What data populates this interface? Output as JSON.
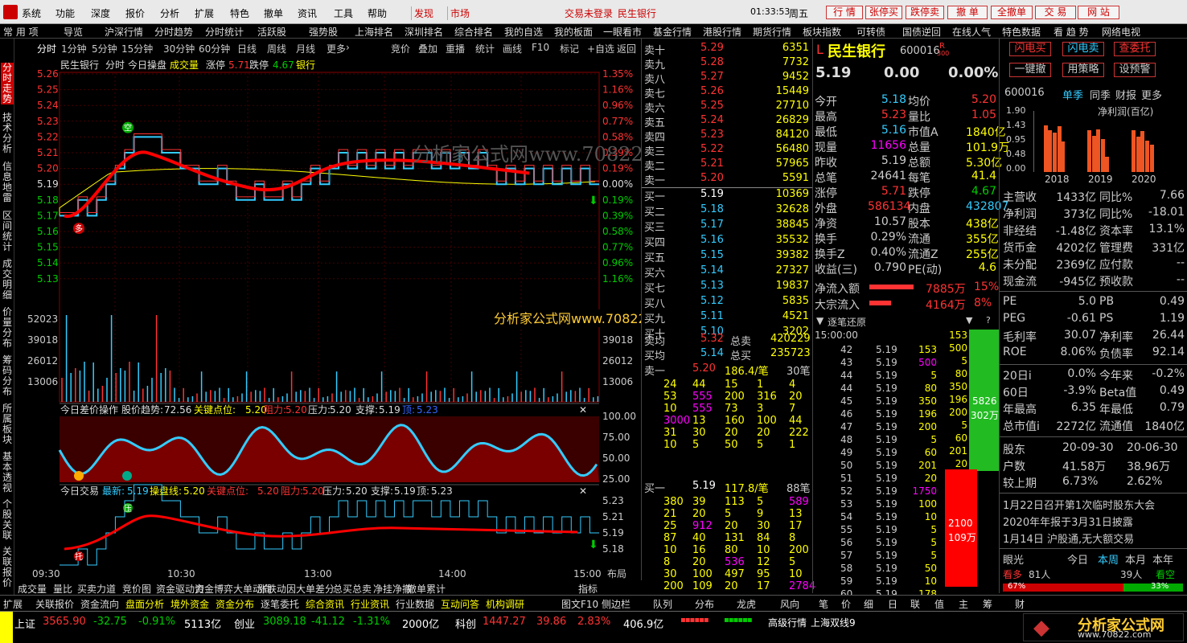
{
  "menu": {
    "items": [
      "系统",
      "功能",
      "深度",
      "报价",
      "分析",
      "扩展",
      "特色",
      "撤单",
      "资讯",
      "工具",
      "帮助"
    ],
    "find": "发现",
    "market": "市场",
    "login_status": "交易未登录",
    "broker": "民生银行",
    "time": "01:33:53",
    "weekday": "周五",
    "buttons": [
      "行 情",
      "张停买",
      "跌停卖",
      "撤 单",
      "全撤单",
      "交 易",
      "网 站"
    ]
  },
  "nav": {
    "items": [
      "常 用 项",
      "导览",
      "沪深行情",
      "分时趋势",
      "分时统计",
      "活跃股",
      "强势股",
      "上海排名",
      "深圳排名",
      "综合排名",
      "我的自选",
      "我的板面",
      "一眼看市",
      "基金行情",
      "港股行情",
      "期货行情",
      "板块指数",
      "可转债",
      "国债逆回",
      "在线人气",
      "特色数据",
      "看 趋 势",
      "网络电视"
    ]
  },
  "leftbar": [
    "分时走势",
    "技术分析",
    "信息地雷",
    "区间统计",
    "成交明细",
    "价量分布",
    "筹码分布",
    "所属板块",
    "基本透视",
    "个股关联",
    "关联报价"
  ],
  "toolbar": {
    "periods": [
      "分时",
      "1分钟",
      "5分钟",
      "15分钟",
      "30分钟",
      "60分钟",
      "日线",
      "周线",
      "月线",
      "更多"
    ],
    "tools": [
      "竞价",
      "叠加",
      "重播",
      "统计",
      "画线",
      "F10",
      "标记",
      "+自选",
      "返回"
    ]
  },
  "chart_header": {
    "name": "民生银行",
    "mode": "分时",
    "today": "今日操盘",
    "cyan_label": "成交量",
    "zt_label": "涨停",
    "zt": "5.71",
    "dt_label": "跌停",
    "dt": "4.67",
    "sector": "银行"
  },
  "watermark": "分析家公式网www.70822.com",
  "watermark_small": "分析家公式网www.70822.com",
  "chart_data": {
    "type": "line",
    "title": "分时趋势",
    "yaxis_left": [
      "5.26",
      "5.25",
      "5.24",
      "5.23",
      "5.22",
      "5.21",
      "5.20",
      "5.19",
      "5.18",
      "5.17",
      "5.16",
      "5.15",
      "5.14",
      "5.13"
    ],
    "yaxis_right": [
      "1.35%",
      "1.16%",
      "0.96%",
      "0.77%",
      "0.58%",
      "0.39%",
      "0.19%",
      "0.00%",
      "0.19%",
      "0.39%",
      "0.58%",
      "0.77%",
      "0.96%",
      "1.16%"
    ],
    "vol_axis": [
      "52023",
      "39018",
      "26012",
      "13006"
    ],
    "xaxis": [
      "09:30",
      "10:30",
      "13:00",
      "14:00",
      "15:00"
    ],
    "prev_close": 5.19,
    "marks": {
      "up": "空",
      "down": "多"
    }
  },
  "panel2": {
    "title": "今日差价操作",
    "l1": "股价趋势:",
    "v1": "72.56",
    "l2": "关键点位:",
    "v2": "5.20",
    "l3": "阻力:",
    "v3": "5.20",
    "l4": "压力:",
    "v4": "5.20",
    "l5": "支撑:",
    "v5": "5.19",
    "l6": "顶:",
    "v6": "5.23",
    "axis": [
      "100.00",
      "75.00",
      "50.00",
      "25.00"
    ]
  },
  "panel3": {
    "title": "今日交易",
    "l1": "最新:",
    "v1": "5.19",
    "l2": "操盘线:",
    "v2": "5.20",
    "l3": "关键点位:",
    "v3": "5.20",
    "l4": "阻力:",
    "v4": "5.20",
    "l5": "压力:",
    "v5": "5.20",
    "l6": "支撑:",
    "v6": "5.19",
    "l7": "顶:",
    "v7": "5.23",
    "axis": [
      "5.23",
      "5.21",
      "5.19",
      "5.18"
    ],
    "marks": {
      "up": "压",
      "down": "托"
    }
  },
  "chart_bottom_tabs": [
    "成交量",
    "量比",
    "买卖力道",
    "竞价图",
    "资金驱动力",
    "资金博弈",
    "大单动向",
    "涨跌动因",
    "大单差分",
    "总买总卖",
    "净挂净撤",
    "撤单累计"
  ],
  "bottom_right": [
    "布局",
    "指标"
  ],
  "orderbook": {
    "sell": [
      [
        "卖十",
        "5.29",
        "6351"
      ],
      [
        "卖九",
        "5.28",
        "7732"
      ],
      [
        "卖八",
        "5.27",
        "9452"
      ],
      [
        "卖七",
        "5.26",
        "15449"
      ],
      [
        "卖六",
        "5.25",
        "27710"
      ],
      [
        "卖五",
        "5.24",
        "26829"
      ],
      [
        "卖四",
        "5.23",
        "84120"
      ],
      [
        "卖三",
        "5.22",
        "56480"
      ],
      [
        "卖二",
        "5.21",
        "57965"
      ],
      [
        "卖一",
        "5.20",
        "5591"
      ]
    ],
    "buy": [
      [
        "买一",
        "5.19",
        "10369"
      ],
      [
        "买二",
        "5.18",
        "32628"
      ],
      [
        "买三",
        "5.17",
        "38845"
      ],
      [
        "买四",
        "5.16",
        "35532"
      ],
      [
        "买五",
        "5.15",
        "39382"
      ],
      [
        "买六",
        "5.14",
        "27327"
      ],
      [
        "买七",
        "5.13",
        "19837"
      ],
      [
        "买八",
        "5.12",
        "5835"
      ],
      [
        "买九",
        "5.11",
        "4521"
      ],
      [
        "买十",
        "5.10",
        "3202"
      ]
    ],
    "avg_sell": [
      "卖均",
      "5.32",
      "总卖",
      "420229"
    ],
    "avg_buy": [
      "买均",
      "5.14",
      "总买",
      "235723"
    ],
    "sell1_q": [
      "卖一",
      "5.20",
      "186.4/笔",
      "30笔"
    ],
    "sell_queue": [
      [
        "24",
        "44",
        "15",
        "1",
        "4"
      ],
      [
        "53",
        "555",
        "200",
        "316",
        "20"
      ],
      [
        "10",
        "555",
        "73",
        "3",
        "7"
      ],
      [
        "3000",
        "13",
        "160",
        "100",
        "44"
      ],
      [
        "31",
        "30",
        "20",
        "20",
        "222"
      ],
      [
        "10",
        "5",
        "50",
        "5",
        "1"
      ]
    ],
    "buy1_q": [
      "买一",
      "5.19",
      "117.8/笔",
      "88笔"
    ],
    "buy_queue": [
      [
        "380",
        "39",
        "113",
        "5",
        "589"
      ],
      [
        "21",
        "20",
        "5",
        "9",
        "13"
      ],
      [
        "25",
        "912",
        "20",
        "30",
        "17"
      ],
      [
        "87",
        "40",
        "131",
        "84",
        "8"
      ],
      [
        "10",
        "16",
        "80",
        "10",
        "200"
      ],
      [
        "8",
        "20",
        "536",
        "12",
        "5"
      ],
      [
        "30",
        "100",
        "497",
        "95",
        "10"
      ],
      [
        "200",
        "109",
        "20",
        "17",
        "2784"
      ]
    ]
  },
  "info": {
    "name": "民生银行",
    "code": "600016",
    "tag": "R",
    "tag2": "300",
    "price": "5.19",
    "change": "0.00",
    "pct": "0.00%",
    "rows": [
      [
        "今开",
        "5.18",
        "均价",
        "5.20"
      ],
      [
        "最高",
        "5.23",
        "量比",
        "1.05"
      ],
      [
        "最低",
        "5.16",
        "市值A",
        "1840亿"
      ],
      [
        "现量",
        "11656",
        "总量",
        "101.9万"
      ],
      [
        "昨收",
        "5.19",
        "总额",
        "5.30亿"
      ],
      [
        "总笔",
        "24641",
        "每笔",
        "41.4"
      ],
      [
        "涨停",
        "5.71",
        "跌停",
        "4.67"
      ],
      [
        "外盘",
        "586134",
        "内盘",
        "432807"
      ],
      [
        "净资",
        "10.57",
        "股本",
        "438亿"
      ],
      [
        "换手",
        "0.29%",
        "流通",
        "355亿"
      ],
      [
        "换手Z",
        "0.40%",
        "流通Z",
        "255亿"
      ],
      [
        "收益(三)",
        "0.790",
        "PE(动)",
        "4.6"
      ]
    ],
    "flow1": [
      "净流入额",
      "7885万",
      "15%"
    ],
    "flow2": [
      "大宗流入",
      "4164万",
      "8%"
    ],
    "restore": "逐笔还原",
    "ticks_head": "15:00:00",
    "ticks": [
      [
        "42",
        "5.19",
        "153"
      ],
      [
        "43",
        "5.19",
        "500"
      ],
      [
        "44",
        "5.19",
        "5"
      ],
      [
        "44",
        "5.19",
        "80"
      ],
      [
        "45",
        "5.19",
        "350"
      ],
      [
        "46",
        "5.19",
        "196"
      ],
      [
        "47",
        "5.19",
        "200"
      ],
      [
        "48",
        "5.19",
        "5"
      ],
      [
        "49",
        "5.19",
        "60"
      ],
      [
        "50",
        "5.19",
        "201"
      ],
      [
        "51",
        "5.19",
        "20"
      ],
      [
        "52",
        "5.19",
        "1750"
      ],
      [
        "53",
        "5.19",
        "100"
      ],
      [
        "54",
        "5.19",
        "10"
      ],
      [
        "55",
        "5.19",
        "5"
      ],
      [
        "56",
        "5.19",
        "5"
      ],
      [
        "57",
        "5.19",
        "5"
      ],
      [
        "58",
        "5.19",
        "50"
      ],
      [
        "59",
        "5.19",
        "10"
      ],
      [
        "60",
        "5.19",
        "178"
      ]
    ],
    "bar_vals": [
      "153",
      "500",
      "5",
      "80",
      "350",
      "196",
      "200",
      "5",
      "60",
      "201",
      "20",
      "100",
      "100",
      "5",
      "5",
      "5",
      "50",
      "10",
      "178"
    ],
    "green_box": [
      "5826",
      "302万"
    ],
    "red_box": [
      "2100",
      "109万"
    ]
  },
  "right": {
    "buttons": [
      "闪电买",
      "闪电卖",
      "查委托",
      "一键撤",
      "用策略",
      "设预警"
    ],
    "code": "600016",
    "tabs": [
      "单季",
      "同季",
      "财报",
      "更多"
    ],
    "mini_chart": {
      "title": "净利润(百亿)",
      "yaxis": [
        "1.90",
        "1.43",
        "0.95",
        "0.48",
        "0.00"
      ],
      "years": [
        "2018",
        "2019",
        "2020"
      ]
    },
    "fin": [
      [
        "主营收",
        "1433亿",
        "同比%",
        "7.66"
      ],
      [
        "净利润",
        "373亿",
        "同比%",
        "-18.01"
      ],
      [
        "非经结",
        "-1.48亿",
        "资本率",
        "13.1%"
      ],
      [
        "货币金",
        "4202亿",
        "管理费",
        "331亿"
      ],
      [
        "未分配",
        "2369亿",
        "应付款",
        "--"
      ],
      [
        "现金流",
        "-945亿",
        "预收款",
        "--"
      ]
    ],
    "val": [
      [
        "PE",
        "5.0",
        "PB",
        "0.49"
      ],
      [
        "PEG",
        "-0.61",
        "PS",
        "1.19"
      ],
      [
        "毛利率",
        "30.07",
        "净利率",
        "26.44"
      ],
      [
        "ROE",
        "8.06%",
        "负债率",
        "92.14"
      ]
    ],
    "perf": [
      [
        "20日i",
        "0.0%",
        "今年来",
        "-0.2%"
      ],
      [
        "60日",
        "-3.9%",
        "Beta值",
        "0.49"
      ],
      [
        "年最高",
        "6.35",
        "年最低",
        "0.79"
      ],
      [
        "总市值i",
        "2272亿",
        "流通值",
        "1840亿"
      ]
    ],
    "holder": [
      [
        "股东",
        "20-09-30",
        "20-06-30"
      ],
      [
        "户数",
        "41.58万",
        "38.96万"
      ],
      [
        "较上期",
        "6.73%",
        "2.62%"
      ]
    ],
    "news": [
      "1月22日召开第1次临时股东大会",
      "2020年年报于3月31日披露",
      "1月14日 沪股通,无大额交易"
    ],
    "eye": [
      "眼光",
      "今日",
      "本周",
      "本月",
      "本年"
    ],
    "bull": [
      "看多",
      "81人",
      "39人",
      "看空"
    ],
    "pct": [
      "67%",
      "33%"
    ]
  },
  "bottom_tabs": [
    "扩展",
    "关联报价",
    "资金流向",
    "盘面分析",
    "境外资金",
    "资金分布",
    "逐笔委托",
    "综合资讯",
    "行业资讯",
    "行业数据",
    "互动问答",
    "机构调研",
    "图文F10",
    "侧边栏",
    "队列",
    "分布",
    "龙虎",
    "风向",
    "笔",
    "价",
    "细",
    "日",
    "联",
    "值",
    "主",
    "筹",
    "财"
  ],
  "status": {
    "sh_label": "上证",
    "sh": "3565.90",
    "sh_chg": "-32.75",
    "sh_pct": "-0.91%",
    "sh_amt": "5113亿",
    "cy_label": "创业",
    "cy": "3089.18",
    "cy_chg": "-41.12",
    "cy_pct": "-1.31%",
    "cy_amt": "2000亿",
    "kc_label": "科创",
    "kc": "1447.27",
    "kc_chg": "39.86",
    "kc_pct": "2.83%",
    "kc_amt": "406.9亿",
    "quote": "高级行情",
    "line": "上海双线9",
    "logo": "分析家公式网",
    "logo_url": "www.70822.com"
  },
  "colors": {
    "up": "#ff3333",
    "down": "#00cc00",
    "cyan": "#33ccff",
    "yellow": "#ffff00",
    "bg": "#000000"
  }
}
